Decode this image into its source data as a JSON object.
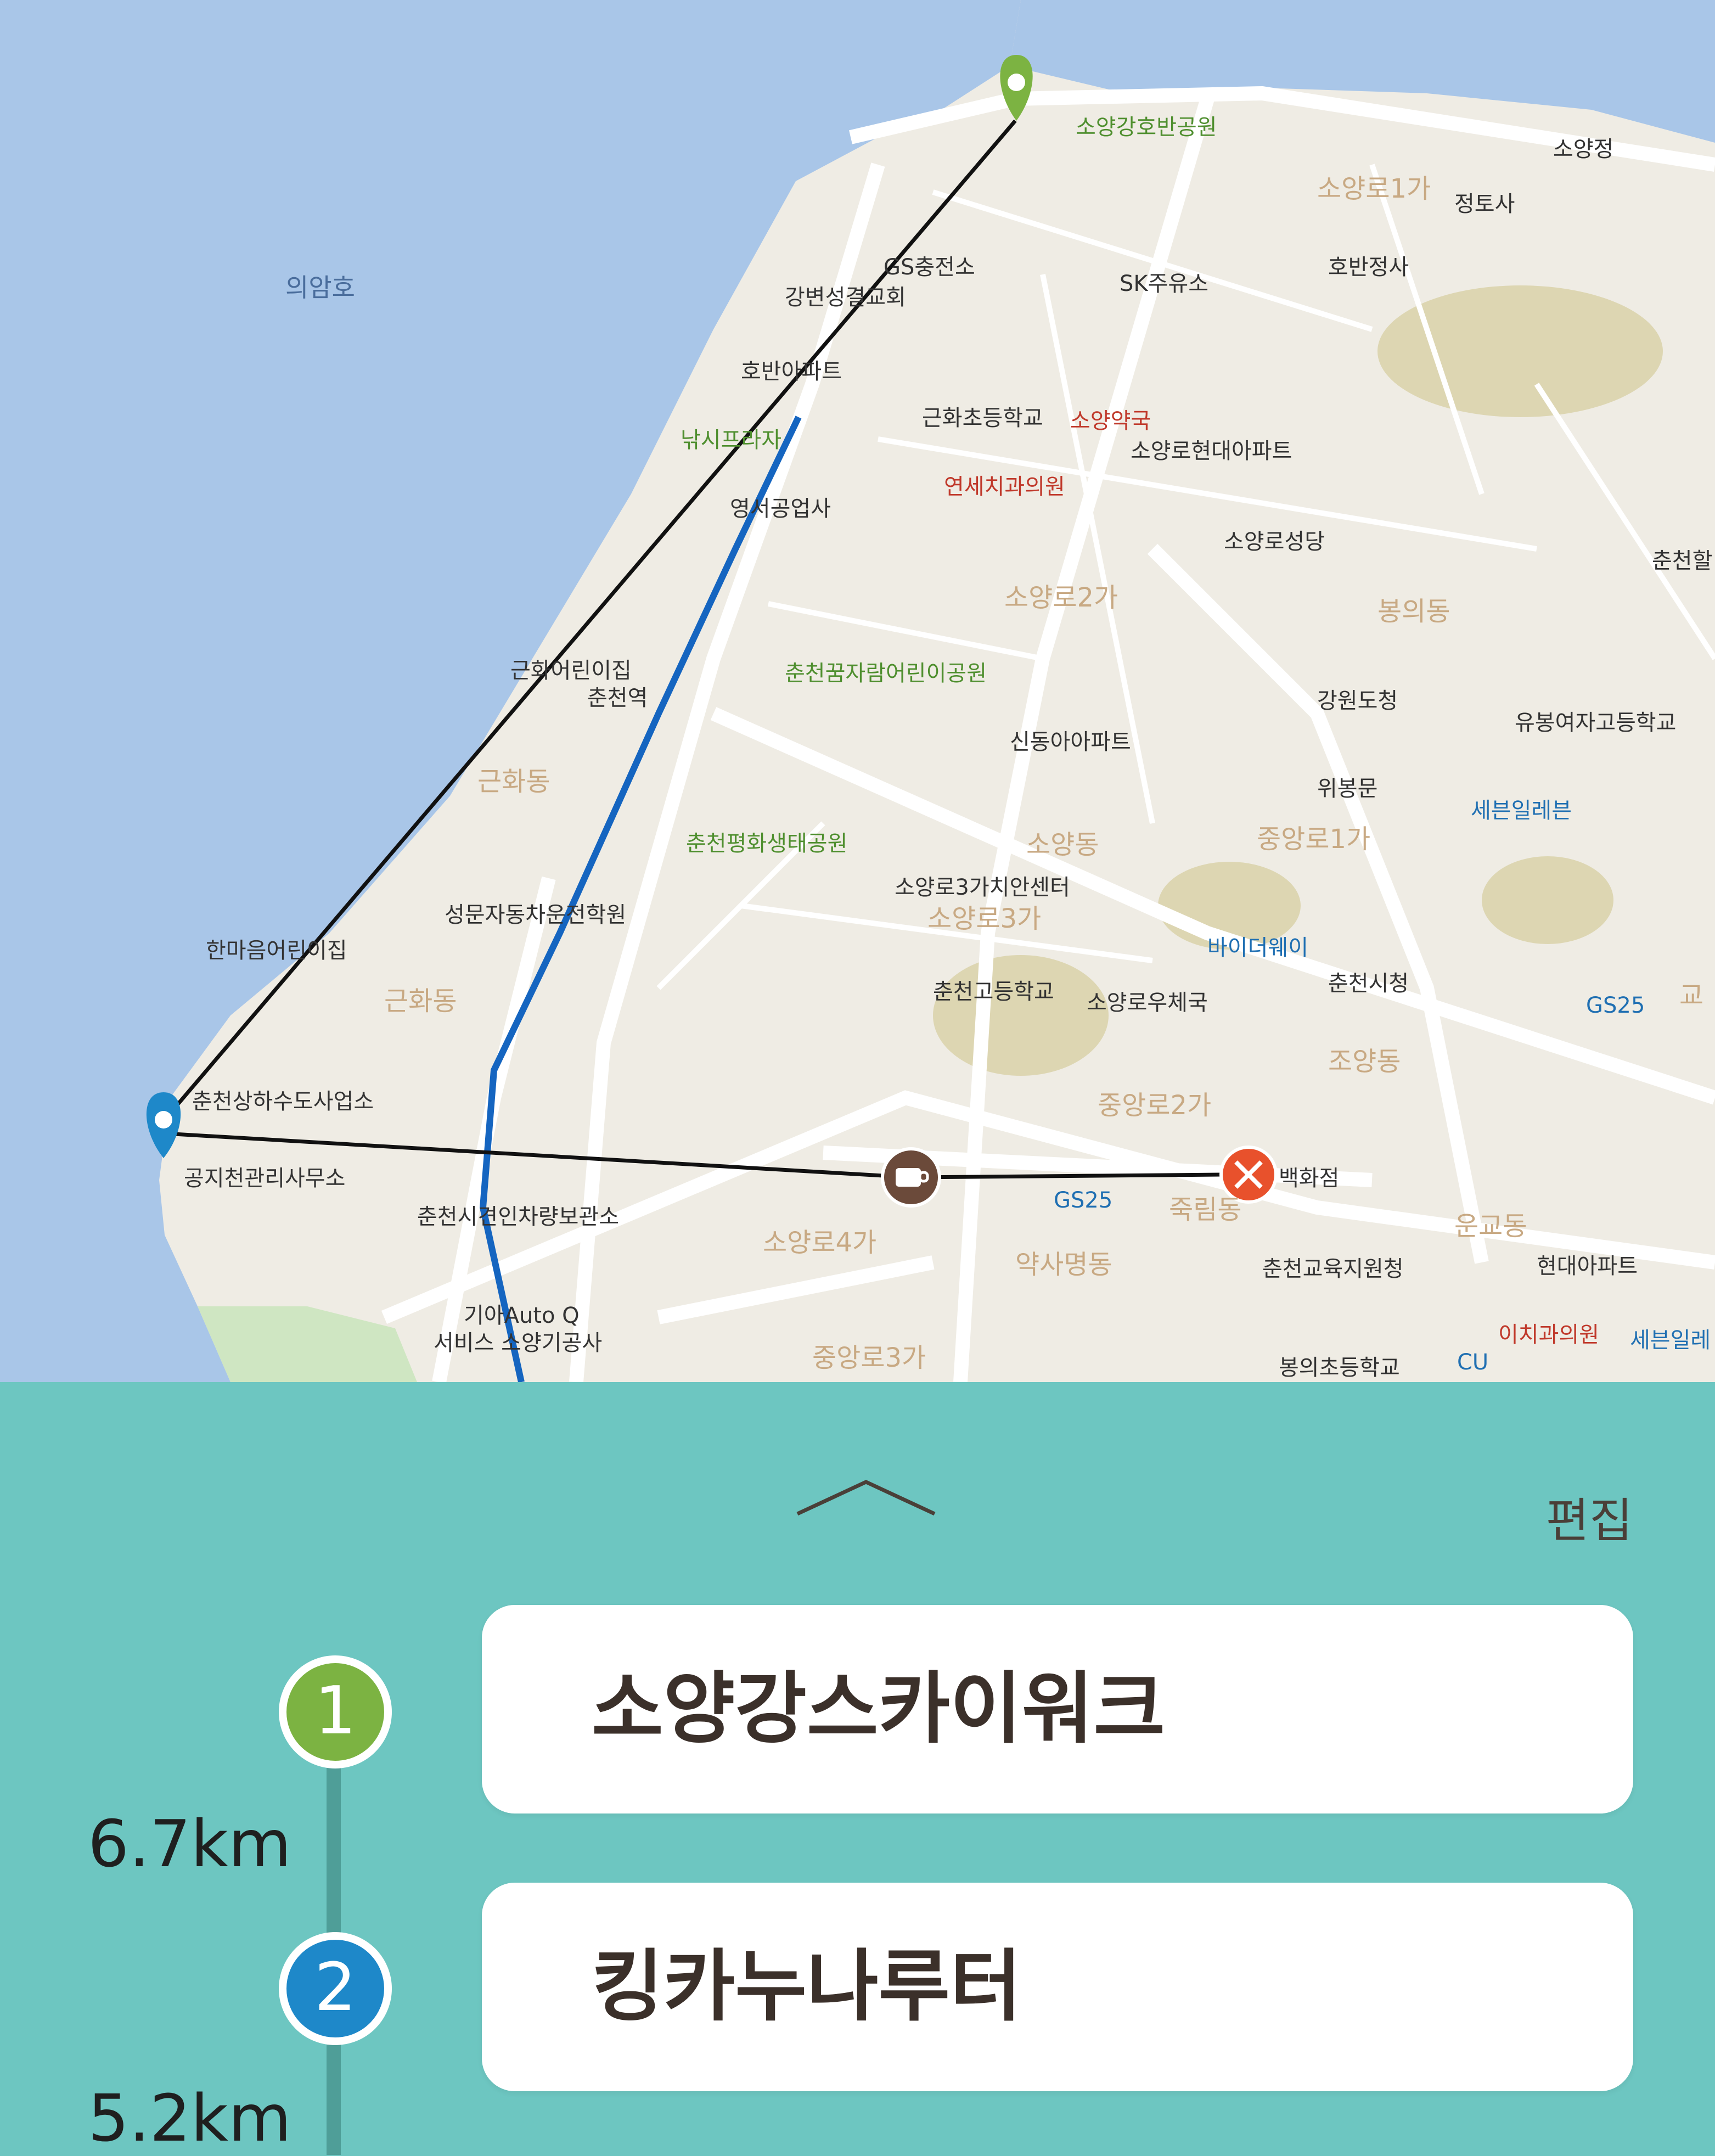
{
  "map": {
    "lake_label": "의암호",
    "labels": [
      {
        "text": "소양강호반공원",
        "color": "#4f8f2f"
      },
      {
        "text": "소양정",
        "color": "#333"
      },
      {
        "text": "소양로1가",
        "color": "#c8a983"
      },
      {
        "text": "정토사",
        "color": "#333"
      },
      {
        "text": "GS충전소",
        "color": "#333"
      },
      {
        "text": "강변성결교회",
        "color": "#333"
      },
      {
        "text": "SK주유소",
        "color": "#333"
      },
      {
        "text": "호반정사",
        "color": "#333"
      },
      {
        "text": "호반아파트",
        "color": "#333"
      },
      {
        "text": "근화초등학교",
        "color": "#333"
      },
      {
        "text": "소양약국",
        "color": "#c0392b"
      },
      {
        "text": "낚시프라자",
        "color": "#4f8f2f"
      },
      {
        "text": "소양로현대아파트",
        "color": "#333"
      },
      {
        "text": "연세치과의원",
        "color": "#c0392b"
      },
      {
        "text": "영서공업사",
        "color": "#333"
      },
      {
        "text": "소양로성당",
        "color": "#333"
      },
      {
        "text": "춘천할",
        "color": "#333"
      },
      {
        "text": "소양로2가",
        "color": "#c8a983"
      },
      {
        "text": "봉의동",
        "color": "#c8a983"
      },
      {
        "text": "근화어린이집",
        "color": "#333"
      },
      {
        "text": "춘천역",
        "color": "#333"
      },
      {
        "text": "춘천꿈자람어린이공원",
        "color": "#4f8f2f"
      },
      {
        "text": "강원도청",
        "color": "#333"
      },
      {
        "text": "유봉여자고등학교",
        "color": "#333"
      },
      {
        "text": "신동아아파트",
        "color": "#333"
      },
      {
        "text": "근화동",
        "color": "#c8a983"
      },
      {
        "text": "위봉문",
        "color": "#333"
      },
      {
        "text": "세븐일레븐",
        "color": "#1f6fb2"
      },
      {
        "text": "춘천평화생태공원",
        "color": "#4f8f2f"
      },
      {
        "text": "소양동",
        "color": "#c8a983"
      },
      {
        "text": "중앙로1가",
        "color": "#c8a983"
      },
      {
        "text": "소양로3가치안센터",
        "color": "#333"
      },
      {
        "text": "소양로3가",
        "color": "#c8a983"
      },
      {
        "text": "성문자동차운전학원",
        "color": "#333"
      },
      {
        "text": "바이더웨이",
        "color": "#1f6fb2"
      },
      {
        "text": "한마음어린이집",
        "color": "#333"
      },
      {
        "text": "춘천시청",
        "color": "#333"
      },
      {
        "text": "춘천고등학교",
        "color": "#333"
      },
      {
        "text": "소양로우체국",
        "color": "#333"
      },
      {
        "text": "GS25",
        "color": "#1f6fb2"
      },
      {
        "text": "근화동",
        "color": "#c8a983"
      },
      {
        "text": "조양동",
        "color": "#c8a983"
      },
      {
        "text": "춘천상하수도사업소",
        "color": "#333"
      },
      {
        "text": "중앙로2가",
        "color": "#c8a983"
      },
      {
        "text": "공지천관리사무소",
        "color": "#333"
      },
      {
        "text": "백화점",
        "color": "#333"
      },
      {
        "text": "GS25",
        "color": "#1f6fb2"
      },
      {
        "text": "춘천시견인차량보관소",
        "color": "#333"
      },
      {
        "text": "죽림동",
        "color": "#c8a983"
      },
      {
        "text": "운교동",
        "color": "#c8a983"
      },
      {
        "text": "소양로4가",
        "color": "#c8a983"
      },
      {
        "text": "약사명동",
        "color": "#c8a983"
      },
      {
        "text": "춘천교육지원청",
        "color": "#333"
      },
      {
        "text": "현대아파트",
        "color": "#333"
      },
      {
        "text": "기아Auto Q",
        "color": "#333"
      },
      {
        "text": "서비스 소양기공사",
        "color": "#333"
      },
      {
        "text": "이치과의원",
        "color": "#c0392b"
      },
      {
        "text": "세븐일레",
        "color": "#1f6fb2"
      },
      {
        "text": "중앙로3가",
        "color": "#c8a983"
      },
      {
        "text": "봉의초등학교",
        "color": "#333"
      },
      {
        "text": "CU",
        "color": "#1f6fb2"
      },
      {
        "text": "교",
        "color": "#c8a983"
      }
    ]
  },
  "panel": {
    "edit_label": "편집",
    "stops": [
      {
        "number": "1",
        "name": "소양강스카이워크",
        "color": "#7cb342"
      },
      {
        "number": "2",
        "name": "킹카누나루터",
        "color": "#1e88c9"
      }
    ],
    "distances": [
      "6.7km",
      "5.2km"
    ]
  },
  "colors": {
    "panel_bg": "#6dc6c1",
    "water": "#a9c6e8",
    "land": "#efece4",
    "rail": "#1565c0",
    "cafe_marker": "#6b4a3a",
    "restaurant_marker": "#e8512c"
  }
}
